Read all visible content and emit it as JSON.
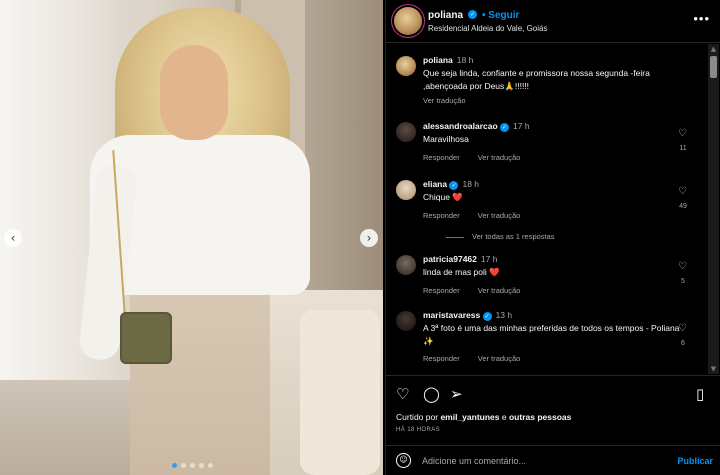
{
  "post": {
    "username": "poliana",
    "follow_label": "Seguir",
    "location": "Residencial Aldeia do Vale, Goiás",
    "more_icon": "more-horizontal-icon",
    "carousel": {
      "total_slides": 5,
      "active_slide": 1
    }
  },
  "caption": {
    "username": "poliana",
    "time": "18 h",
    "text": "Que seja linda, confiante e promissora nossa segunda -feira ,abençoada por Deus🙏!!!!!!",
    "translate": "Ver tradução"
  },
  "comments": [
    {
      "username": "alessandroalarcao",
      "time": "17 h",
      "text": "Maravilhosa",
      "reply": "Responder",
      "translate": "Ver tradução",
      "likes": "11"
    },
    {
      "username": "eliana",
      "time": "18 h",
      "text": "Chique ❤️",
      "reply": "Responder",
      "translate": "Ver tradução",
      "likes": "49"
    },
    {
      "username": "patricia97462",
      "time": "17 h",
      "text": "linda de mas poli ❤️",
      "reply": "Responder",
      "translate": "Ver tradução",
      "likes": "5"
    },
    {
      "username": "maristavaress",
      "time": "13 h",
      "text": "A 3ª foto é uma das minhas preferidas de todos os tempos - Poliana ✨",
      "reply": "Responder",
      "translate": "Ver tradução",
      "likes": "6"
    }
  ],
  "view_replies": "Ver todas as 1 respostas",
  "likes_line": {
    "prefix": "Curtido por",
    "user": "emil_yantunes",
    "and": "e",
    "others": "outras pessoas"
  },
  "time_ago": "HÁ 18 HORAS",
  "comment_box": {
    "placeholder": "Adicione um comentário...",
    "publish": "Publicar"
  },
  "colors": {
    "accent": "#0095f6",
    "heart_red": "#ed4956",
    "background": "#000000"
  }
}
